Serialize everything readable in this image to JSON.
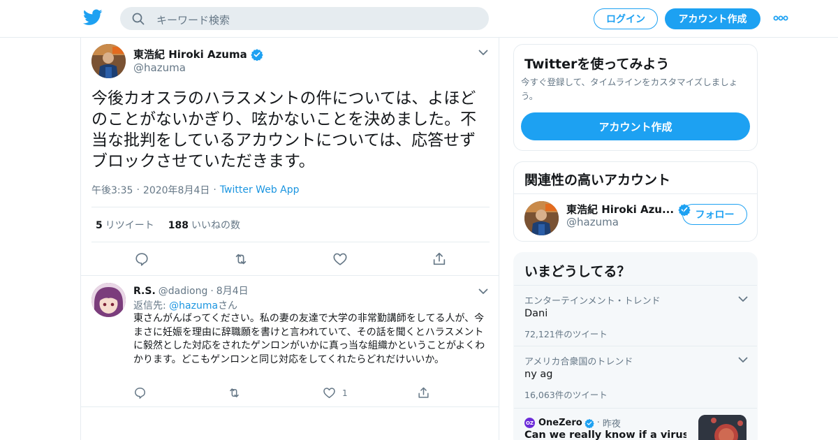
{
  "header": {
    "search_placeholder": "キーワード検索",
    "login_label": "ログイン",
    "signup_label": "アカウント作成"
  },
  "tweet": {
    "author_name": "東浩紀 Hiroki Azuma",
    "author_handle": "@hazuma",
    "text": "今後カオスラのハラスメントの件については、よほどのことがないかぎり、呟かないことを決めました。不当な批判をしているアカウントについては、応答せずブロックさせていただきます。",
    "time": "午後3:35",
    "date": "2020年8月4日",
    "client": "Twitter Web App",
    "retweet_count": "5",
    "retweet_label": "リツイート",
    "like_count": "188",
    "like_label": "いいねの数"
  },
  "reply": {
    "author_name": "R.S.",
    "author_handle": "@dadiong",
    "date": "8月4日",
    "reply_to_prefix": "返信先: ",
    "reply_to_mention": "@hazuma",
    "reply_to_suffix": "さん",
    "text": "東さんがんばってください。私の妻の友達で大学の非常勤講師をしてる人が、今まさに妊娠を理由に辞職願を書けと言われていて、その話を聞くとハラスメントに毅然とした対応をされたゲンロンがいかに真っ当な組織かということがよくわかります。どこもゲンロンと同じ対応をしてくれたらどれだけいいか。",
    "like_count": "1"
  },
  "sidebar": {
    "signup_card": {
      "title": "Twitterを使ってみよう",
      "subtitle": "今すぐ登録して、タイムラインをカスタマイズしましょう。",
      "button_label": "アカウント作成"
    },
    "related": {
      "title": "関連性の高いアカウント",
      "name": "東浩紀 Hiroki Azu...",
      "handle": "@hazuma",
      "follow_label": "フォロー"
    },
    "trends": {
      "title": "いまどうしてる？",
      "items": [
        {
          "context": "エンターテインメント・トレンド",
          "name": "Dani",
          "count": "72,121件のツイート"
        },
        {
          "context": "アメリカ合衆国のトレンド",
          "name": "ny ag",
          "count": "16,063件のツイート"
        }
      ],
      "news": {
        "logo_text": "OZ",
        "source": "OneZero",
        "time": "昨夜",
        "headline": "Can we really know if a virus was"
      }
    }
  },
  "colors": {
    "accent": "#1da1f2",
    "link": "#1b95e0",
    "muted": "#657786",
    "border": "#e6ecf0",
    "verified": "#1da1f2"
  },
  "icons": [
    "twitter-bird-icon",
    "search-icon",
    "more-icon",
    "verified-icon",
    "chevron-down-icon",
    "reply-icon",
    "retweet-icon",
    "like-icon",
    "share-icon"
  ]
}
